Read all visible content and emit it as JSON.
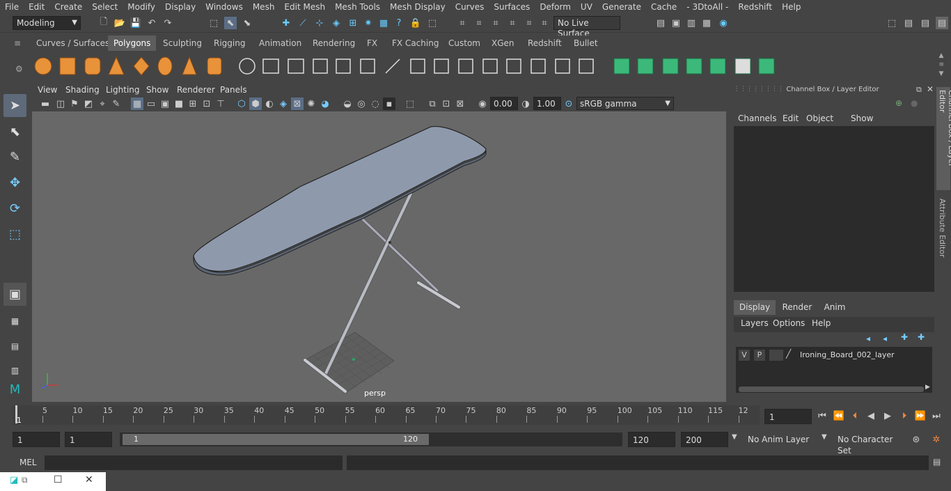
{
  "menu": [
    "File",
    "Edit",
    "Create",
    "Select",
    "Modify",
    "Display",
    "Windows",
    "Mesh",
    "Edit Mesh",
    "Mesh Tools",
    "Mesh Display",
    "Curves",
    "Surfaces",
    "Deform",
    "UV",
    "Generate",
    "Cache",
    "- 3DtoAll -",
    "Redshift",
    "Help"
  ],
  "status": {
    "workspace": "Modeling",
    "live_surface": "No Live Surface"
  },
  "shelf_tabs": [
    "Curves / Surfaces",
    "Polygons",
    "Sculpting",
    "Rigging",
    "Animation",
    "Rendering",
    "FX",
    "FX Caching",
    "Custom",
    "XGen",
    "Redshift",
    "Bullet"
  ],
  "shelf_active": "Polygons",
  "viewport": {
    "menu": [
      "View",
      "Shading",
      "Lighting",
      "Show",
      "Renderer",
      "Panels"
    ],
    "exposure": "0.00",
    "gamma": "1.00",
    "color_space": "sRGB gamma",
    "camera_label": "persp"
  },
  "channel_box": {
    "title": "Channel Box / Layer Editor",
    "menu": [
      "Channels",
      "Edit",
      "Object",
      "Show"
    ],
    "tabs": [
      "Display",
      "Render",
      "Anim"
    ],
    "active_tab": "Display",
    "layer_menu": [
      "Layers",
      "Options",
      "Help"
    ],
    "layer": {
      "v": "V",
      "p": "P",
      "name": "Ironing_Board_002_layer"
    }
  },
  "side_tabs": [
    "Channel Box / Layer Editor",
    "Attribute Editor"
  ],
  "timeline": {
    "ticks": [
      "5",
      "10",
      "15",
      "20",
      "25",
      "30",
      "35",
      "40",
      "45",
      "50",
      "55",
      "60",
      "65",
      "70",
      "75",
      "80",
      "85",
      "90",
      "95",
      "100",
      "105",
      "110",
      "115",
      "12"
    ],
    "start_marker": "1",
    "current_frame": "1"
  },
  "range": {
    "start": "1",
    "start2": "1",
    "slider_start": "1",
    "slider_end": "120",
    "end": "120",
    "end2": "200",
    "anim_layer": "No Anim Layer",
    "char_set": "No Character Set"
  },
  "command": {
    "label": "MEL"
  },
  "colors": {
    "bg": "#444444",
    "viewport": "#686868",
    "accent": "#5d5d5d",
    "board": "#8e9aac"
  }
}
